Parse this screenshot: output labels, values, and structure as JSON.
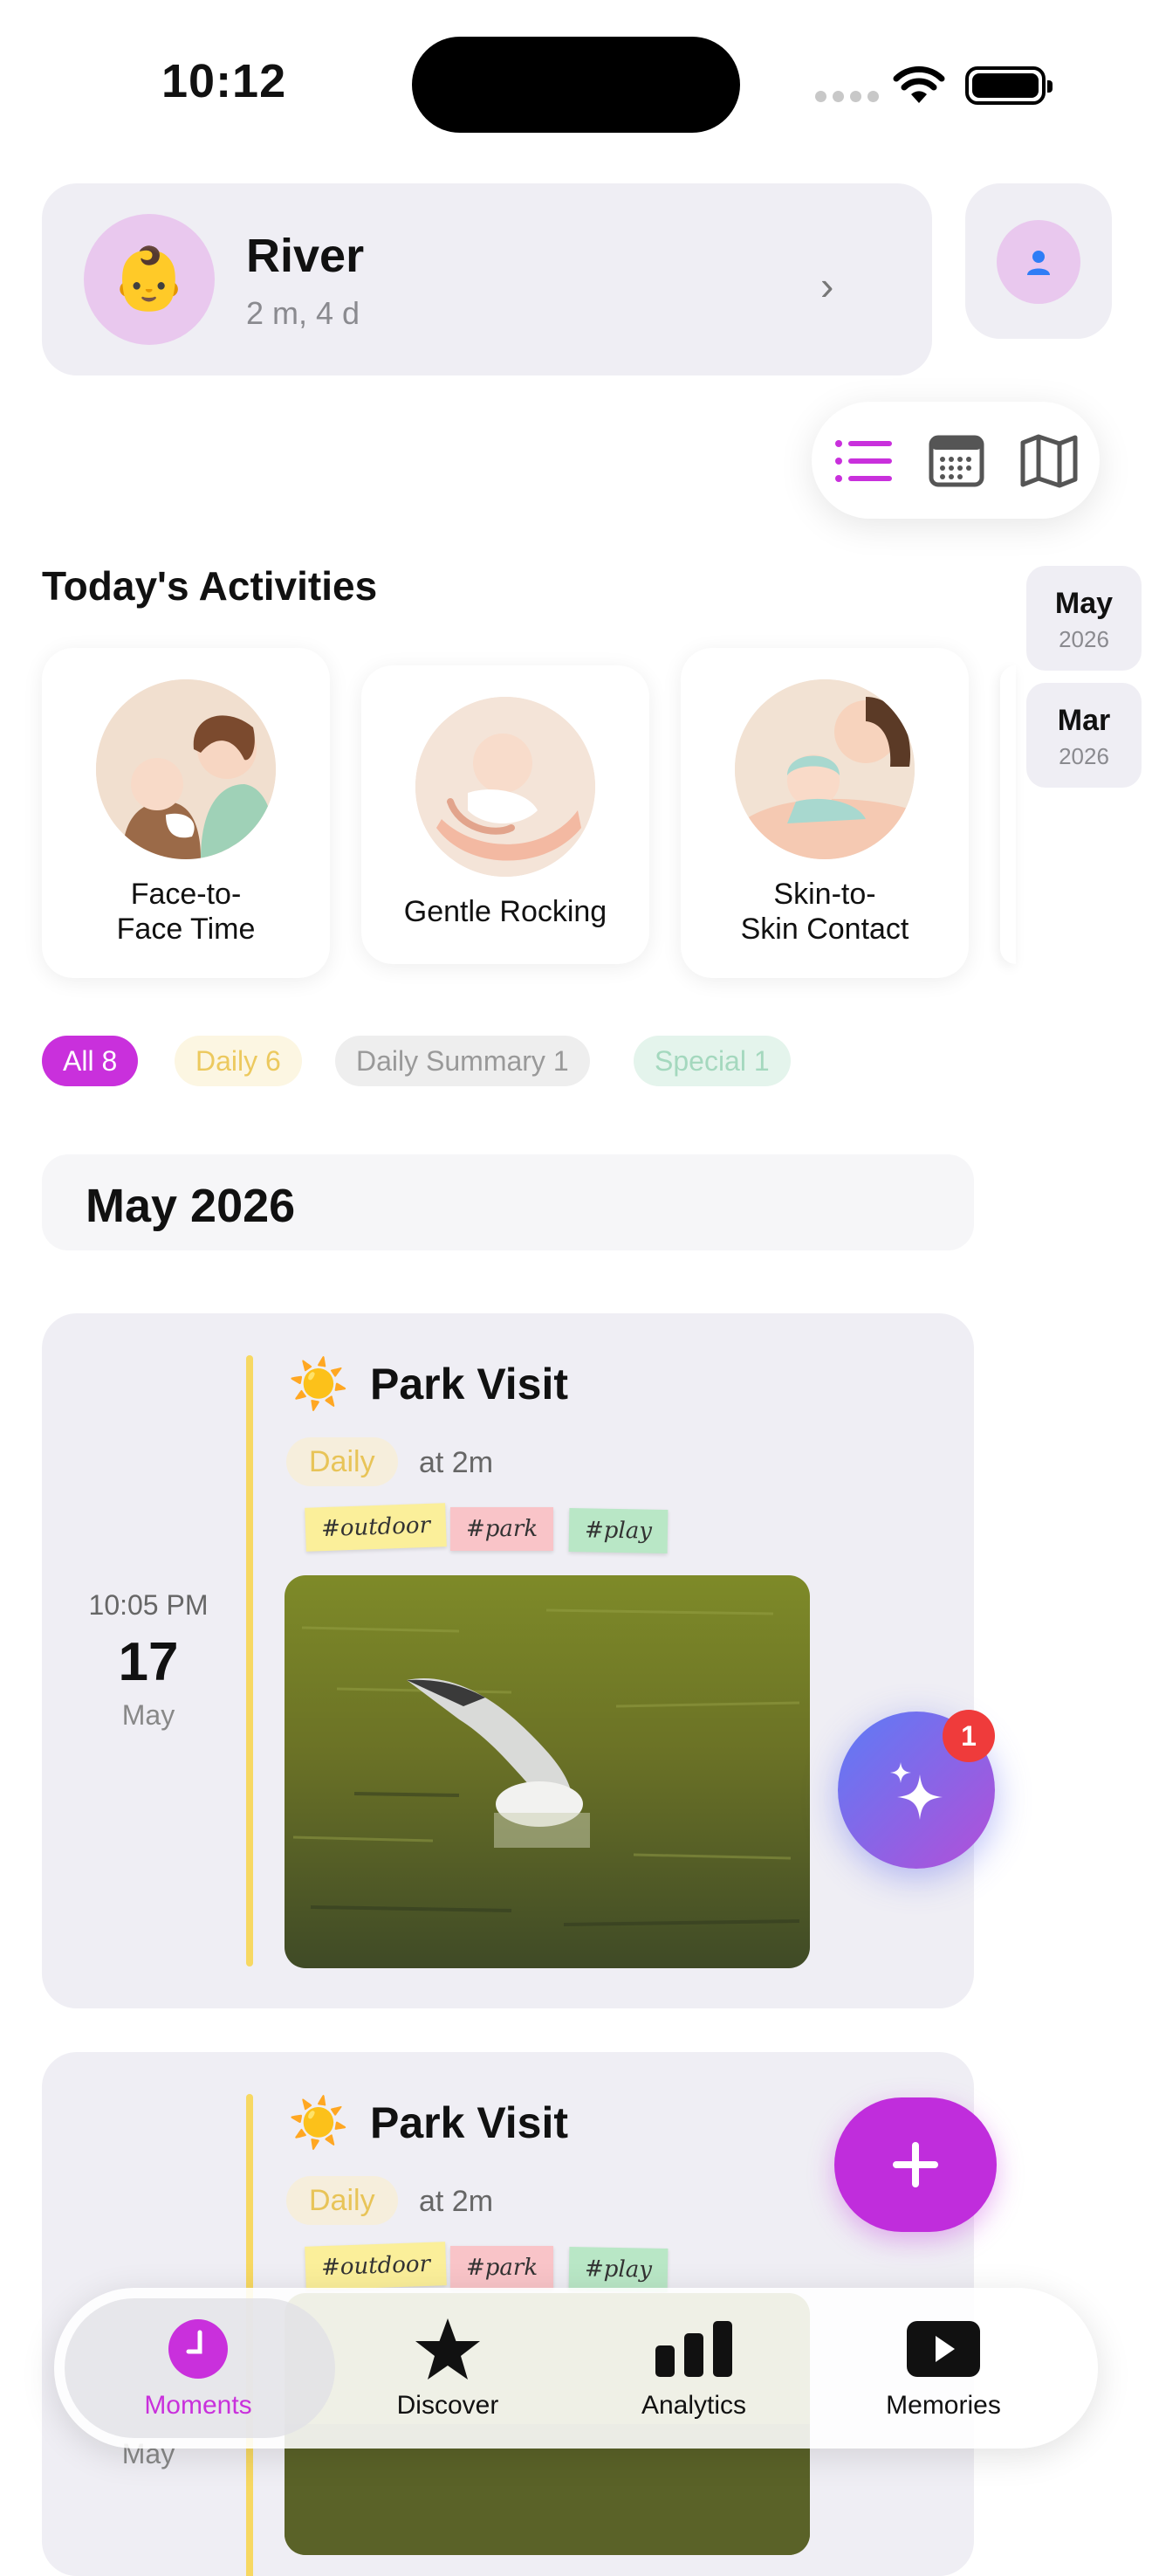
{
  "status_bar": {
    "time": "10:12"
  },
  "profile": {
    "name": "River",
    "age": "2 m, 4 d",
    "avatar_emoji": "👶"
  },
  "view_switcher": {
    "active": "list",
    "options": [
      "list-icon",
      "calendar-icon",
      "map-icon"
    ]
  },
  "today": {
    "title": "Today's Activities",
    "activities": [
      {
        "label": "Face-to-\nFace Time"
      },
      {
        "label": "Gentle Rocking"
      },
      {
        "label": "Skin-to-\nSkin Contact"
      }
    ]
  },
  "month_index": [
    {
      "month": "May",
      "year": "2026"
    },
    {
      "month": "Mar",
      "year": "2026"
    }
  ],
  "filters": [
    {
      "label": "All 8",
      "bg": "#c930dc",
      "fg": "#ffffff"
    },
    {
      "label": "Daily 6",
      "bg": "#fcf6e2",
      "fg": "#ecc95e"
    },
    {
      "label": "Daily Summary 1",
      "bg": "#eeeeee",
      "fg": "#999999"
    },
    {
      "label": "Special 1",
      "bg": "#e4f4ec",
      "fg": "#a4d8be"
    }
  ],
  "timeline": {
    "month_header": "May 2026",
    "entries": [
      {
        "time": "10:05 PM",
        "day": "17",
        "month": "May",
        "icon": "☀️",
        "title": "Park Visit",
        "category": "Daily",
        "age": "at 2m",
        "tags": [
          "#outdoor",
          "#park",
          "#play"
        ]
      },
      {
        "time": "",
        "day": "",
        "month": "May",
        "icon": "☀️",
        "title": "Park Visit",
        "category": "Daily",
        "age": "at 2m",
        "tags": [
          "#outdoor",
          "#park",
          "#play"
        ]
      }
    ]
  },
  "ai_assistant": {
    "badge": "1"
  },
  "tabbar": {
    "tabs": [
      {
        "label": "Moments",
        "icon": "clock-icon",
        "active": true
      },
      {
        "label": "Discover",
        "icon": "star-icon",
        "active": false
      },
      {
        "label": "Analytics",
        "icon": "bar-chart-icon",
        "active": false
      },
      {
        "label": "Memories",
        "icon": "play-icon",
        "active": false
      }
    ]
  },
  "colors": {
    "accent": "#c930dc",
    "card_bg": "#efeef4",
    "daily_bar": "#f7d862"
  }
}
